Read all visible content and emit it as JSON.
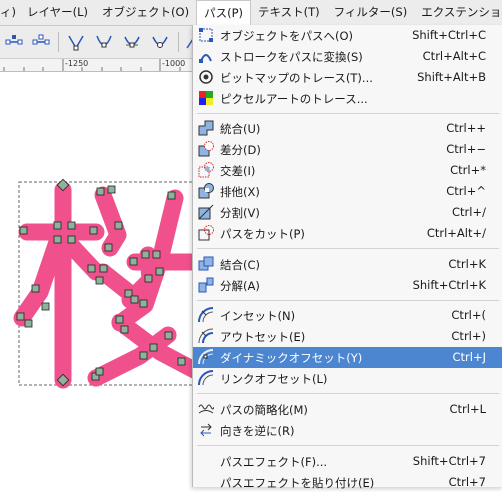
{
  "menubar": {
    "items": [
      {
        "label": "レイヤー(L)"
      },
      {
        "label": "オブジェクト(O)"
      },
      {
        "label": "パス(P)"
      },
      {
        "label": "テキスト(T)"
      },
      {
        "label": "フィルター(S)"
      },
      {
        "label": "エクステンショ"
      }
    ],
    "left_fragment": "ィ)"
  },
  "ruler": {
    "label1": "-1250",
    "label2": "-1000"
  },
  "path_menu": {
    "items": [
      {
        "label": "オブジェクトをパスへ(O)",
        "shortcut": "Shift+Ctrl+C"
      },
      {
        "label": "ストロークをパスに変換(S)",
        "shortcut": "Ctrl+Alt+C"
      },
      {
        "label": "ビットマップのトレース(T)...",
        "shortcut": "Shift+Alt+B"
      },
      {
        "label": "ピクセルアートのトレース...",
        "shortcut": ""
      },
      {
        "label": "統合(U)",
        "shortcut": "Ctrl++"
      },
      {
        "label": "差分(D)",
        "shortcut": "Ctrl+−"
      },
      {
        "label": "交差(I)",
        "shortcut": "Ctrl+*"
      },
      {
        "label": "排他(X)",
        "shortcut": "Ctrl+^"
      },
      {
        "label": "分割(V)",
        "shortcut": "Ctrl+/"
      },
      {
        "label": "パスをカット(P)",
        "shortcut": "Ctrl+Alt+/"
      },
      {
        "label": "結合(C)",
        "shortcut": "Ctrl+K"
      },
      {
        "label": "分解(A)",
        "shortcut": "Shift+Ctrl+K"
      },
      {
        "label": "インセット(N)",
        "shortcut": "Ctrl+("
      },
      {
        "label": "アウトセット(E)",
        "shortcut": "Ctrl+)"
      },
      {
        "label": "ダイナミックオフセット(Y)",
        "shortcut": "Ctrl+J"
      },
      {
        "label": "リンクオフセット(L)",
        "shortcut": ""
      },
      {
        "label": "パスの簡略化(M)",
        "shortcut": "Ctrl+L"
      },
      {
        "label": "向きを逆に(R)",
        "shortcut": ""
      },
      {
        "label": "パスエフェクト(F)...",
        "shortcut": "Shift+Ctrl+7"
      },
      {
        "label": "パスエフェクトを貼り付け(E)",
        "shortcut": "Ctrl+7"
      }
    ],
    "selected_label": "ダイナミックオフセット(Y)"
  },
  "colors": {
    "accent": "#4c86d0",
    "glyph_pink": "#f0508c",
    "node_fill": "#8fb29a"
  }
}
